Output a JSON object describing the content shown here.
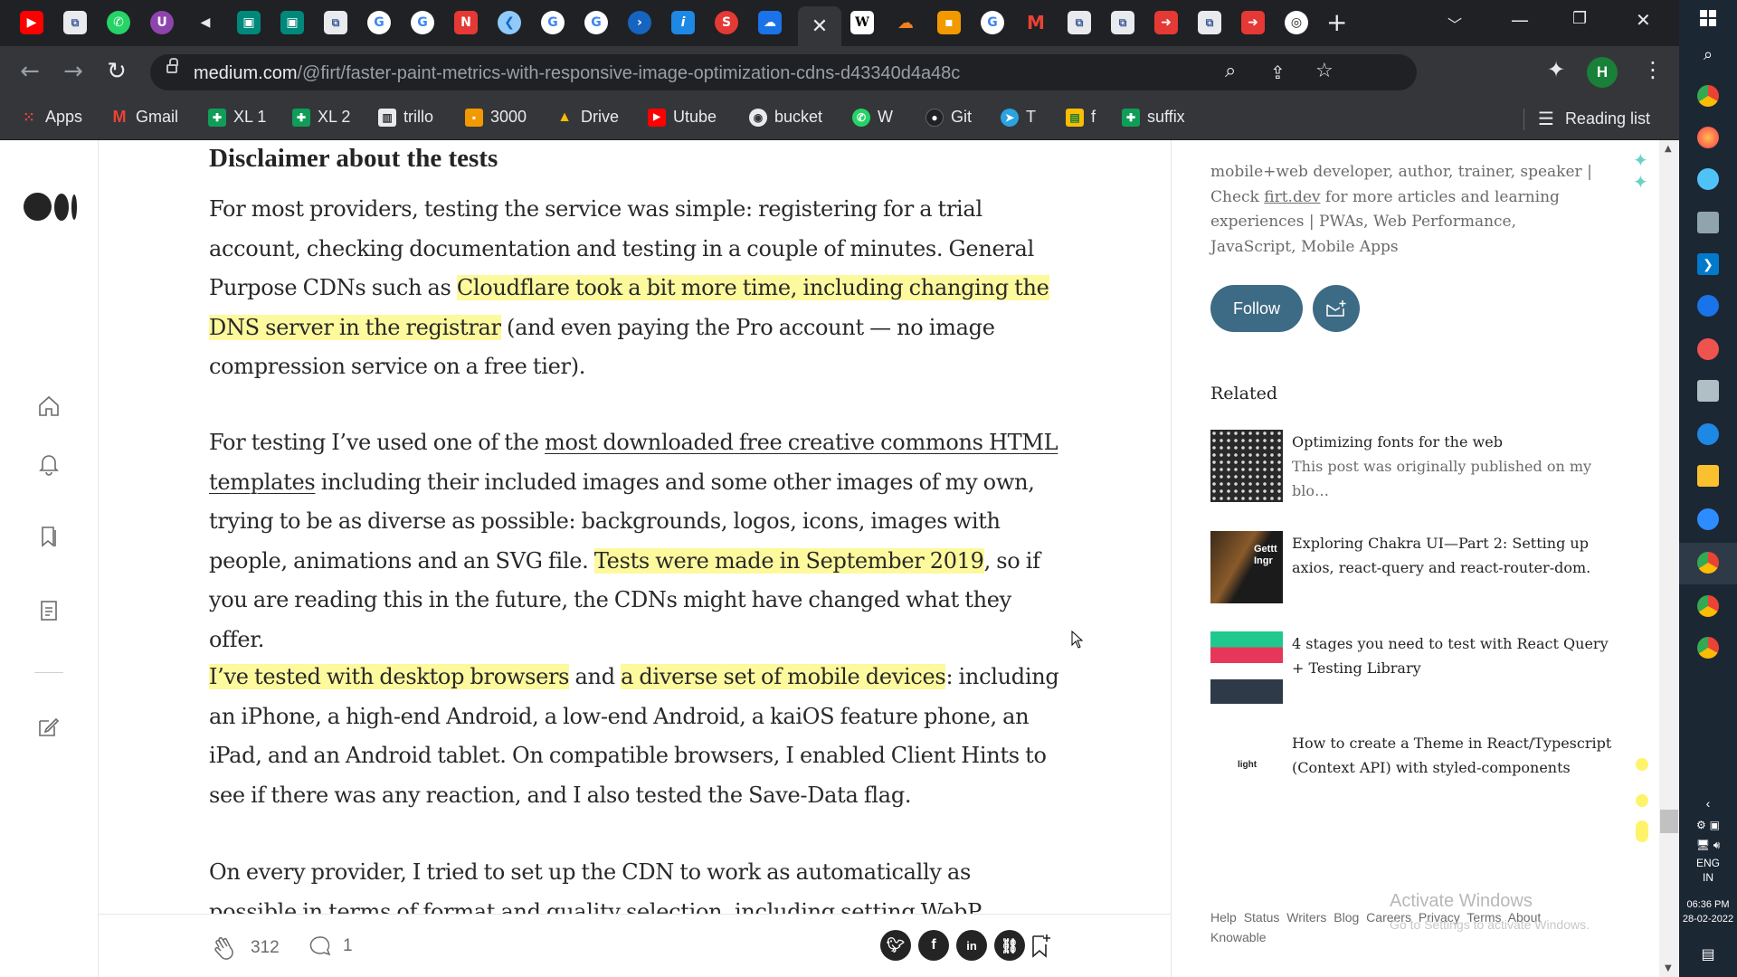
{
  "browser": {
    "tabs": {
      "active_close": "✕",
      "new_tab": "+"
    },
    "url": {
      "host": "medium.com",
      "path": "/@firt/faster-paint-metrics-with-responsive-image-optimization-cdns-d43340d4a48c"
    },
    "profile_initial": "H",
    "bookmarks": [
      {
        "label": "Apps",
        "icon": "apps-grid-icon",
        "color": "#ea4335"
      },
      {
        "label": "Gmail",
        "icon": "gmail-icon",
        "color": "#ea4335"
      },
      {
        "label": "XL 1",
        "icon": "sheets-icon",
        "color": "#0f9d58"
      },
      {
        "label": "XL 2",
        "icon": "sheets-icon",
        "color": "#0f9d58"
      },
      {
        "label": "trillo",
        "icon": "trello-icon",
        "color": "#e8eaed"
      },
      {
        "label": "3000",
        "icon": "bookmark-orange-icon",
        "color": "#f29900"
      },
      {
        "label": "Drive",
        "icon": "drive-icon",
        "color": "#fbbc04"
      },
      {
        "label": "Utube",
        "icon": "youtube-icon",
        "color": "#ff0000"
      },
      {
        "label": "bucket",
        "icon": "globe-icon",
        "color": "#e8eaed"
      },
      {
        "label": "W",
        "icon": "whatsapp-icon",
        "color": "#25d366"
      },
      {
        "label": "Git",
        "icon": "github-icon",
        "color": "#202124"
      },
      {
        "label": "T",
        "icon": "telegram-icon",
        "color": "#2aa3e0"
      },
      {
        "label": "f",
        "icon": "folder-icon",
        "color": "#fbbc04"
      },
      {
        "label": "suffix",
        "icon": "sheets-icon",
        "color": "#0f9d58"
      }
    ],
    "reading_list": "Reading list"
  },
  "article": {
    "heading": "Disclaimer about the tests",
    "p1": {
      "a": "For most providers, testing the service was simple: registering for a trial account, checking documentation and testing in a couple of minutes. General Purpose CDNs such as ",
      "hl": "Cloudflare took a bit more time, including changing the DNS server in the registrar",
      "b": " (and even paying the Pro account — no image compression service on a free tier)."
    },
    "p2": {
      "a": "For testing I’ve used one of the ",
      "link": "most downloaded free creative commons HTML templates",
      "b": " including their included images and some other images of my own, trying to be as diverse as possible: backgrounds, logos, icons, images with people, animations and an SVG file. ",
      "hl": "Tests were made in September 2019",
      "c": ", so if you are reading this in the future, the CDNs might have changed what they offer."
    },
    "p3": {
      "hl1": "I’ve tested with desktop browsers",
      "a": " and ",
      "hl2": "a diverse set of mobile devices",
      "b": ": including an iPhone, a high-end Android, a low-end Android, a kaiOS feature phone, an iPad, and an Android tablet. On compatible browsers, I enabled Client Hints to see if there was any reaction, and I also tested the Save-Data flag."
    },
    "p4": "On every provider, I tried to set up the CDN to work as automatically as possible in terms of format and quality selection, including setting WebP automatic"
  },
  "actions": {
    "claps": "312",
    "responses": "1"
  },
  "sidebar": {
    "bio_a": "mobile+web developer, author, trainer, speaker | Check ",
    "bio_link": "firt.dev",
    "bio_b": " for more articles and learning experiences | PWAs, Web Performance, JavaScript, Mobile Apps",
    "follow": "Follow",
    "related_heading": "Related",
    "related": [
      {
        "title": "Optimizing fonts for the web",
        "subtitle": "This post was originally published on my blo…"
      },
      {
        "title": "Exploring Chakra UI—Part 2: Setting up axios, react-query and react-router-dom.",
        "subtitle": ""
      },
      {
        "title": "4 stages you need to test with React Query + Testing Library",
        "subtitle": ""
      },
      {
        "title": "How to create a Theme in React/Typescript (Context API) with styled-components",
        "subtitle": ""
      }
    ],
    "footer": [
      "Help",
      "Status",
      "Writers",
      "Blog",
      "Careers",
      "Privacy",
      "Terms",
      "About",
      "Knowable"
    ],
    "thumb_text_2": "Gettt Ingr",
    "thumb_text_4": "light"
  },
  "watermark": {
    "title": "Activate Windows",
    "subtitle": "Go to Settings to activate Windows."
  },
  "taskbar": {
    "lang": "ENG",
    "region": "IN",
    "time": "06:36 PM",
    "date": "28-02-2022"
  }
}
